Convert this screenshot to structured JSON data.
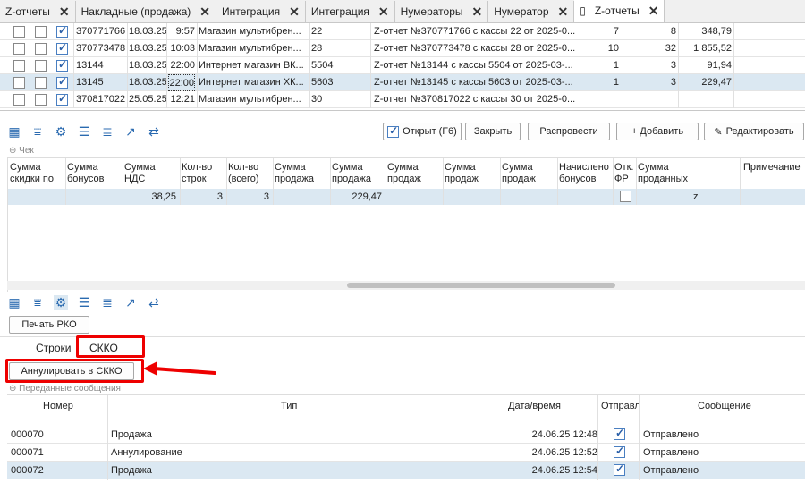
{
  "tabs": [
    {
      "label": "Z-отчеты",
      "active": false
    },
    {
      "label": "Накладные (продажа)",
      "active": false
    },
    {
      "label": "Интеграция",
      "active": false
    },
    {
      "label": "Интеграция",
      "active": false
    },
    {
      "label": "Нумераторы",
      "active": false
    },
    {
      "label": "Нумератор",
      "active": false
    },
    {
      "label": "Z-отчеты",
      "active": true
    }
  ],
  "top_rows": [
    {
      "c1": false,
      "c2": false,
      "c3": true,
      "num": "370771766",
      "date": "18.03.25",
      "time": "9:57",
      "store": "Магазин мультибрен...",
      "kassa": "22",
      "desc": "Z-отчет №370771766 с кассы 22 от 2025-0...",
      "a": "7",
      "b": "8",
      "sum": "348,79",
      "selected": false
    },
    {
      "c1": false,
      "c2": false,
      "c3": true,
      "num": "370773478",
      "date": "18.03.25",
      "time": "10:03",
      "store": "Магазин мультибрен...",
      "kassa": "28",
      "desc": "Z-отчет №370773478 с кассы 28 от 2025-0...",
      "a": "10",
      "b": "32",
      "sum": "1 855,52",
      "selected": false
    },
    {
      "c1": false,
      "c2": false,
      "c3": true,
      "num": "13144",
      "date": "18.03.25",
      "time": "22:00",
      "store": "Интернет магазин ВК...",
      "kassa": "5504",
      "desc": "Z-отчет №13144 с кассы 5504 от 2025-03-...",
      "a": "1",
      "b": "3",
      "sum": "91,94",
      "selected": false
    },
    {
      "c1": false,
      "c2": false,
      "c3": true,
      "num": "13145",
      "date": "18.03.25",
      "time": "22:00",
      "store": "Интернет магазин ХК...",
      "kassa": "5603",
      "desc": "Z-отчет №13145 с кассы 5603 от 2025-03-...",
      "a": "1",
      "b": "3",
      "sum": "229,47",
      "selected": true
    },
    {
      "c1": false,
      "c2": false,
      "c3": true,
      "num": "370817022",
      "date": "25.05.25",
      "time": "12:21",
      "store": "Магазин мультибрен...",
      "kassa": "30",
      "desc": "Z-отчет №370817022 с кассы 30 от 2025-0...",
      "a": "",
      "b": "",
      "sum": "",
      "selected": false
    }
  ],
  "toolbar1": {
    "open_label": "Открыт (F6)",
    "close_label": "Закрыть",
    "post_label": "Распровести",
    "add_label": "+ Добавить",
    "edit_label": "Редактировать"
  },
  "check": {
    "section": "Чек",
    "headers": [
      {
        "l1": "Сумма",
        "l2": "скидки по"
      },
      {
        "l1": "Сумма",
        "l2": "бонусов"
      },
      {
        "l1": "Сумма",
        "l2": "НДС"
      },
      {
        "l1": "Кол-во",
        "l2": "строк"
      },
      {
        "l1": "Кол-во",
        "l2": "(всего)"
      },
      {
        "l1": "Сумма",
        "l2": "продажа"
      },
      {
        "l1": "Сумма",
        "l2": "продажа"
      },
      {
        "l1": "Сумма",
        "l2": "продаж"
      },
      {
        "l1": "Сумма",
        "l2": "продаж"
      },
      {
        "l1": "Сумма",
        "l2": "продаж"
      },
      {
        "l1": "Начислено",
        "l2": "бонусов"
      },
      {
        "l1": "Отк.",
        "l2": "ФР"
      },
      {
        "l1": "Сумма",
        "l2": "проданных"
      }
    ],
    "note_header": "Примечание",
    "row": {
      "nds": "38,25",
      "lines": "3",
      "total": "3",
      "sale": "229,47",
      "z": "z"
    }
  },
  "print_rko": "Печать РКО",
  "subtabs": {
    "lines": "Строки",
    "skko": "СККО"
  },
  "annul_button": "Аннулировать в СККО",
  "messages": {
    "section": "Переданные сообщения",
    "headers": {
      "num": "Номер",
      "type": "Тип",
      "dt": "Дата/время",
      "sent": "Отправл",
      "msg": "Сообщение"
    },
    "rows": [
      {
        "num": "000070",
        "type": "Продажа",
        "dt": "24.06.25 12:48",
        "sent": true,
        "msg": "Отправлено",
        "selected": false
      },
      {
        "num": "000071",
        "type": "Аннулирование",
        "dt": "24.06.25 12:52",
        "sent": true,
        "msg": "Отправлено",
        "selected": false
      },
      {
        "num": "000072",
        "type": "Продажа",
        "dt": "24.06.25 12:54",
        "sent": true,
        "msg": "Отправлено",
        "selected": true
      }
    ]
  },
  "accent": "#e00000"
}
